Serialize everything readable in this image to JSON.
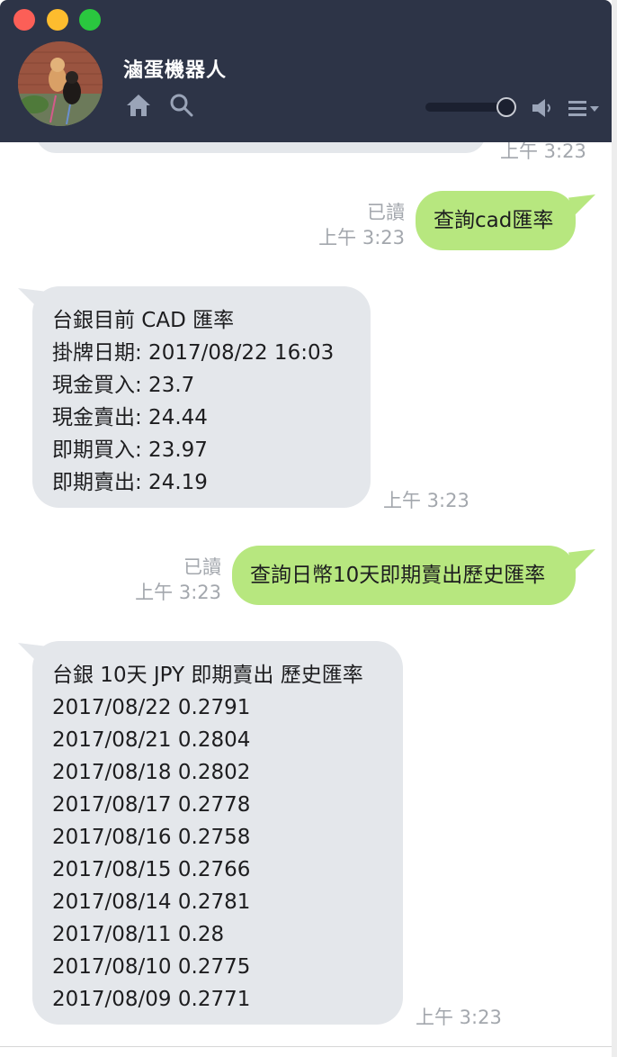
{
  "window": {
    "title": "滷蛋機器人"
  },
  "header": {
    "icons": [
      "home-icon",
      "search-icon",
      "speaker-icon",
      "menu-icon"
    ],
    "volume_level": 0.85,
    "background_color": "#2d3447"
  },
  "chat": {
    "previous_time": "上午 3:23",
    "messages": [
      {
        "sender": "me",
        "read_label": "已讀",
        "time": "上午 3:23",
        "text": "查詢cad匯率"
      },
      {
        "sender": "bot",
        "time": "上午 3:23",
        "lines": [
          "台銀目前 CAD 匯率",
          "掛牌日期: 2017/08/22 16:03",
          "現金買入: 23.7",
          "現金賣出: 24.44",
          "即期買入: 23.97",
          "即期賣出: 24.19"
        ]
      },
      {
        "sender": "me",
        "read_label": "已讀",
        "time": "上午 3:23",
        "text": "查詢日幣10天即期賣出歷史匯率"
      },
      {
        "sender": "bot",
        "time": "上午 3:23",
        "lines": [
          "台銀 10天 JPY 即期賣出 歷史匯率",
          "2017/08/22 0.2791",
          "2017/08/21 0.2804",
          "2017/08/18 0.2802",
          "2017/08/17 0.2778",
          "2017/08/16 0.2758",
          "2017/08/15 0.2766",
          "2017/08/14 0.2781",
          "2017/08/11 0.28",
          "2017/08/10 0.2775",
          "2017/08/09 0.2771"
        ]
      }
    ]
  },
  "colors": {
    "my_bubble": "#b7e77f",
    "bot_bubble": "#e4e7eb",
    "meta_text": "#a3a7ad"
  }
}
